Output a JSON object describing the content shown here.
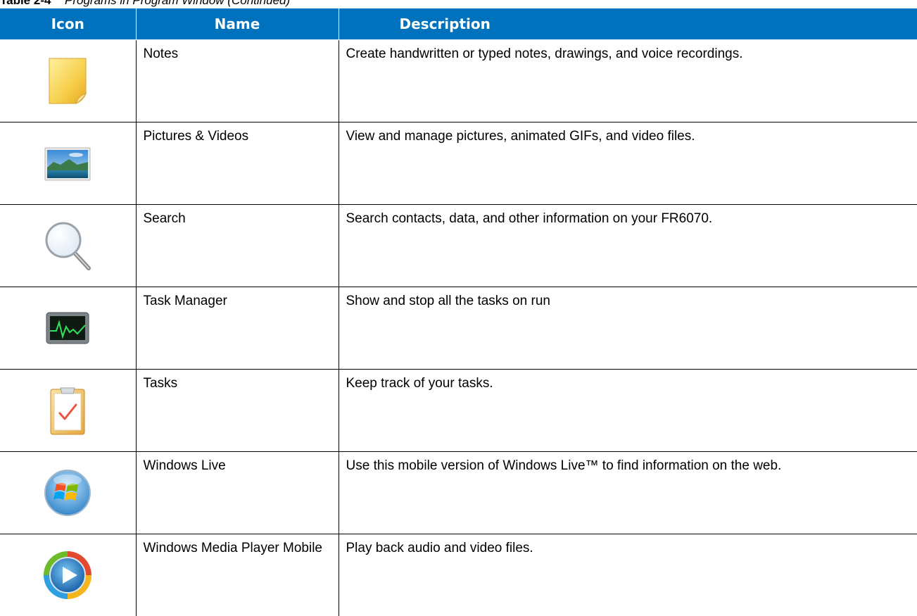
{
  "caption": {
    "label": "Table 2-4",
    "title": "Programs in Program Window (Continued)"
  },
  "table": {
    "headers": {
      "icon": "Icon",
      "name": "Name",
      "description": "Description"
    },
    "rows": [
      {
        "icon": "notes-icon",
        "name": "Notes",
        "description": "Create handwritten or typed notes, drawings, and voice recordings."
      },
      {
        "icon": "pictures-videos-icon",
        "name": "Pictures & Videos",
        "description": "View and manage pictures, animated GIFs, and video files."
      },
      {
        "icon": "search-icon",
        "name": "Search",
        "description": "Search contacts, data, and other information on your FR6070."
      },
      {
        "icon": "task-manager-icon",
        "name": "Task Manager",
        "description": "Show and stop all the tasks on run"
      },
      {
        "icon": "tasks-icon",
        "name": "Tasks",
        "description": "Keep track of your tasks."
      },
      {
        "icon": "windows-live-icon",
        "name": "Windows Live",
        "description": "Use this mobile version of Windows Live™ to find information on the web."
      },
      {
        "icon": "windows-media-player-icon",
        "name": "Windows Media Player Mobile",
        "description": "Play back audio and video files."
      }
    ]
  },
  "colors": {
    "header_background": "#0071bc",
    "header_text": "#ffffff"
  }
}
